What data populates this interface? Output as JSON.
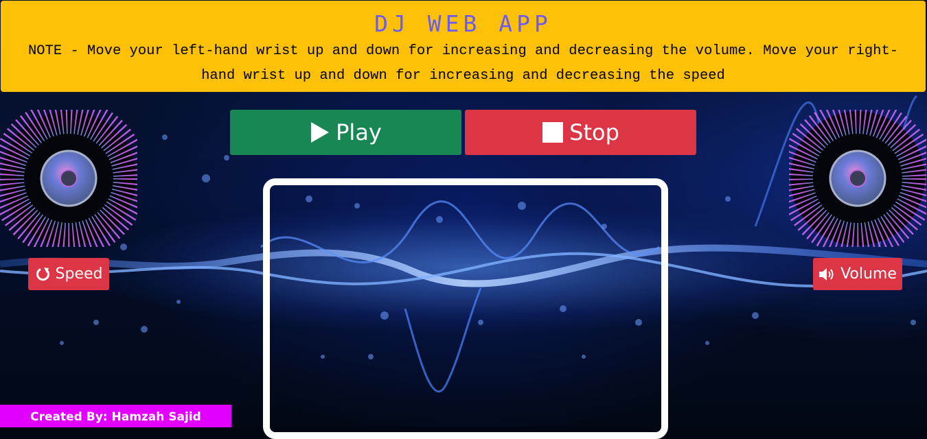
{
  "header": {
    "title": "DJ WEB APP",
    "note": "NOTE - Move your left-hand wrist up and down for increasing and decreasing the volume. Move your right-hand wrist up and down for increasing and decreasing the speed"
  },
  "controls": {
    "play_label": "Play",
    "stop_label": "Stop",
    "speed_label": "Speed",
    "volume_label": "Volume"
  },
  "icons": {
    "play": "play-icon",
    "stop": "stop-icon",
    "speed": "rotate-icon",
    "volume": "volume-icon"
  },
  "footer": {
    "credit": "Created By: Hamzah Sajid"
  },
  "colors": {
    "header_bg": "#ffc107",
    "title": "#6a5cf2",
    "play_bg": "#198754",
    "stop_bg": "#dc3545",
    "credit_bg": "#e100ff"
  }
}
